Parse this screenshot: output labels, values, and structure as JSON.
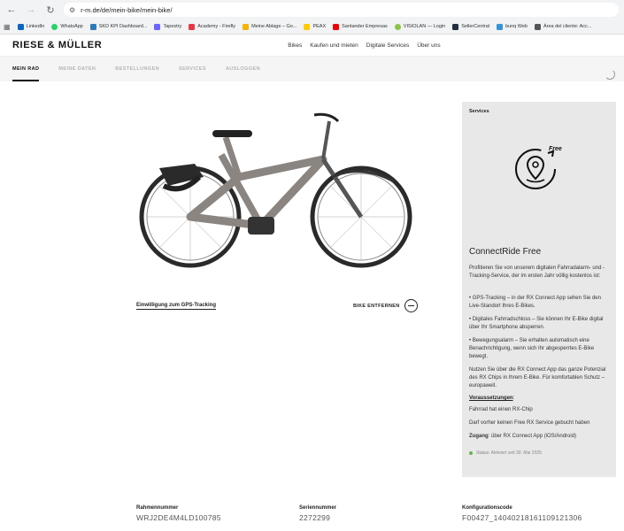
{
  "browser": {
    "url": "r-m.de/de/mein-bike/mein-bike/",
    "bookmarks": [
      {
        "label": "LinkedIn",
        "color": "#0a66c2"
      },
      {
        "label": "WhatsApp",
        "color": "#25d366"
      },
      {
        "label": "SKD KPI Dashboard...",
        "color": "#2b7bb9"
      },
      {
        "label": "Tapestry",
        "color": "#6c63ff"
      },
      {
        "label": "Academy - Firefly",
        "color": "#e63946"
      },
      {
        "label": "Meine Ablage – Go...",
        "color": "#f4b400"
      },
      {
        "label": "PEAX",
        "color": "#ffcc00"
      },
      {
        "label": "Santander Empresas",
        "color": "#ec0000"
      },
      {
        "label": "VISIOLAN — Login",
        "color": "#8bc34a"
      },
      {
        "label": "SellerCentral",
        "color": "#232f3e"
      },
      {
        "label": "bunq Web",
        "color": "#3394d7"
      },
      {
        "label": "Área del cliente: Acc...",
        "color": "#555555"
      }
    ]
  },
  "header": {
    "logo": "RIESE & MÜLLER",
    "nav": [
      "Bikes",
      "Kaufen und mieten",
      "Digitale Services",
      "Über uns"
    ]
  },
  "subnav": [
    "MEIN RAD",
    "MEINE DATEN",
    "BESTELLUNGEN",
    "SERVICES",
    "AUSLOGGEN"
  ],
  "bike": {
    "gps_link": "Einwilligung zum GPS-Tracking",
    "remove_label": "BIKE ENTFERNEN"
  },
  "services": {
    "heading": "Services",
    "icon_badge": "Free",
    "title": "ConnectRide Free",
    "intro": "Profitieren Sie von unserem digitalen Fahrradalarm- und -Tracking-Service, der im ersten Jahr völlig kostenlos ist:",
    "bullets": [
      "• GPS-Tracking – in der RX Connect App sehen Sie den Live-Standort Ihres E-Bikes.",
      "• Digitales Fahrradschloss – Sie können Ihr E-Bike digital über Ihr Smartphone absperren.",
      "• Bewegungsalarm – Sie erhalten automatisch eine Benachrichtigung, wenn sich Ihr abgesperrtes E-Bike bewegt."
    ],
    "outro": "Nutzen Sie über die RX Connect App das ganze Potenzial des RX Chips in Ihrem E-Bike. Für komfortablen Schutz – europaweit.",
    "req_heading": "Voraussetzungen",
    "req_heading_suffix": ":",
    "requirements": [
      "Fahrrad hat einen RX-Chip",
      "Darf vorher keinen Free RX Service gebucht haben"
    ],
    "access_label": "Zugang",
    "access_text": ": über RX Connect App (iOS/Android)",
    "status": "Status: Aktiviert seit 30. Mai 2025"
  },
  "info": {
    "frame_label": "Rahmennummer",
    "frame_value": "WRJ2DE4M4LD100785",
    "serial_label": "Seriennummer",
    "serial_value": "2272299",
    "config_label": "Konfigurationscode",
    "config_value": "F00427_14040218161109121306"
  }
}
